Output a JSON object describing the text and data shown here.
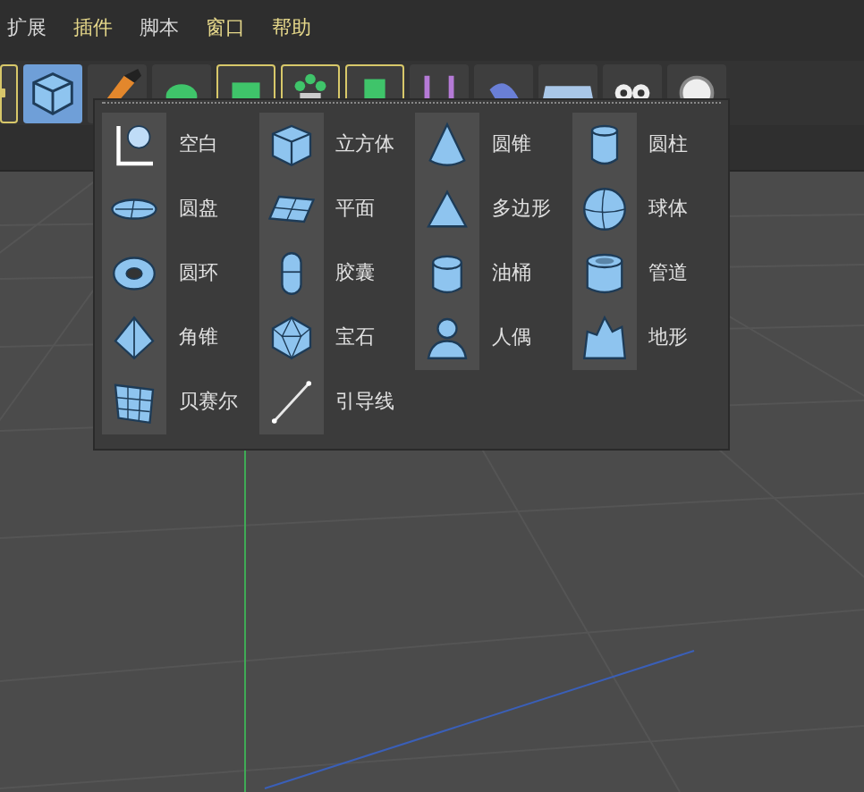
{
  "menu_bar": [
    {
      "label": "扩展",
      "color": "#d8d8d8"
    },
    {
      "label": "插件",
      "color": "#e6d88a"
    },
    {
      "label": "脚本",
      "color": "#d8d8d8"
    },
    {
      "label": "窗口",
      "color": "#e6d88a"
    },
    {
      "label": "帮助",
      "color": "#e6d88a"
    }
  ],
  "toolbar": [
    {
      "selected": false,
      "framed": true
    },
    {
      "selected": true,
      "framed": false
    },
    {
      "selected": false,
      "framed": false
    },
    {
      "selected": false,
      "framed": false
    },
    {
      "selected": false,
      "framed": true
    },
    {
      "selected": false,
      "framed": true
    },
    {
      "selected": false,
      "framed": true
    },
    {
      "selected": false,
      "framed": false
    },
    {
      "selected": false,
      "framed": false
    },
    {
      "selected": false,
      "framed": false
    },
    {
      "selected": false,
      "framed": false
    },
    {
      "selected": false,
      "framed": false
    }
  ],
  "object_menu": {
    "items": [
      {
        "label": "空白"
      },
      {
        "label": "立方体"
      },
      {
        "label": "圆锥"
      },
      {
        "label": "圆柱"
      },
      {
        "label": "圆盘"
      },
      {
        "label": "平面"
      },
      {
        "label": "多边形"
      },
      {
        "label": "球体"
      },
      {
        "label": "圆环"
      },
      {
        "label": "胶囊"
      },
      {
        "label": "油桶"
      },
      {
        "label": "管道"
      },
      {
        "label": "角锥"
      },
      {
        "label": "宝石"
      },
      {
        "label": "人偶"
      },
      {
        "label": "地形"
      },
      {
        "label": "贝赛尔"
      },
      {
        "label": "引导线"
      }
    ]
  }
}
